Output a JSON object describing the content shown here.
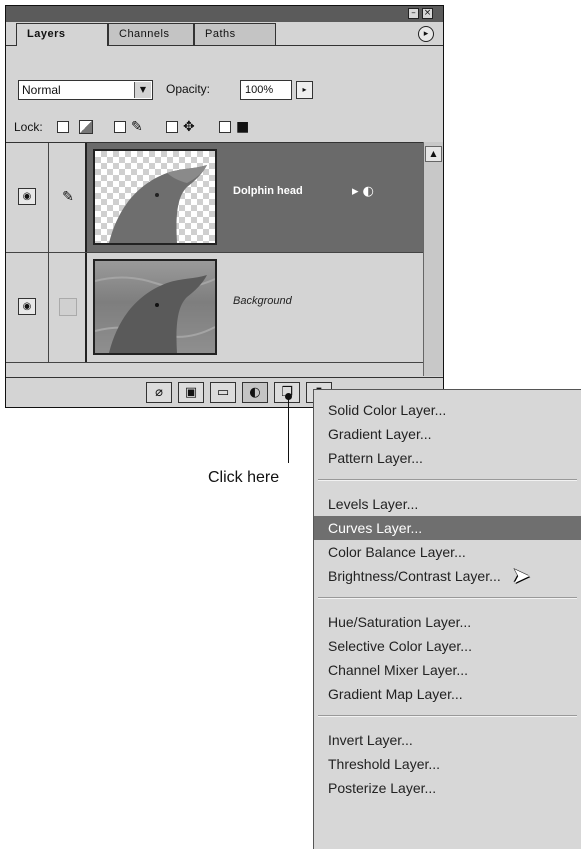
{
  "panel": {
    "tabs": [
      {
        "label": "Layers",
        "active": true
      },
      {
        "label": "Channels",
        "active": false
      },
      {
        "label": "Paths",
        "active": false
      }
    ],
    "window_buttons": {
      "minimize": "–",
      "close": "×"
    },
    "menu_button_icon": "▸",
    "blend_mode": "Normal",
    "blend_arrow": "▼",
    "opacity_label": "Opacity:",
    "opacity_value": "100%",
    "opacity_arrow": "▸",
    "lock_label": "Lock:",
    "layers": [
      {
        "name": "Dolphin head",
        "selected": true,
        "linked_icon": "brush-icon",
        "has_effects": true,
        "effect_glyph": "▸ ◐"
      },
      {
        "name": "Background",
        "selected": false,
        "linked_icon": "",
        "has_effects": false
      }
    ],
    "eye_glyph": "◉",
    "brush_glyph": "✎",
    "bottom_buttons": [
      {
        "name": "layer-style-icon",
        "glyph": "⌀"
      },
      {
        "name": "mask-icon",
        "glyph": "▣"
      },
      {
        "name": "folder-icon",
        "glyph": "▭"
      },
      {
        "name": "adjustment-layer-icon",
        "glyph": "◐"
      },
      {
        "name": "new-layer-icon",
        "glyph": "❐"
      },
      {
        "name": "trash-icon",
        "glyph": "▮"
      }
    ]
  },
  "callout": {
    "text": "Click here"
  },
  "menu": {
    "groups": [
      [
        "Solid Color Layer...",
        "Gradient Layer...",
        "Pattern Layer..."
      ],
      [
        "Levels Layer...",
        "Curves Layer...",
        "Color Balance Layer...",
        "Brightness/Contrast Layer..."
      ],
      [
        "Hue/Saturation Layer...",
        "Selective Color Layer...",
        "Channel Mixer Layer...",
        "Gradient Map Layer..."
      ],
      [
        "Invert Layer...",
        "Threshold Layer...",
        "Posterize Layer..."
      ]
    ],
    "highlighted": "Curves Layer..."
  },
  "colors": {
    "panel_bg": "#d4d4d4",
    "selection": "#6a6a6a",
    "menu_highlight": "#6f6f6f"
  }
}
